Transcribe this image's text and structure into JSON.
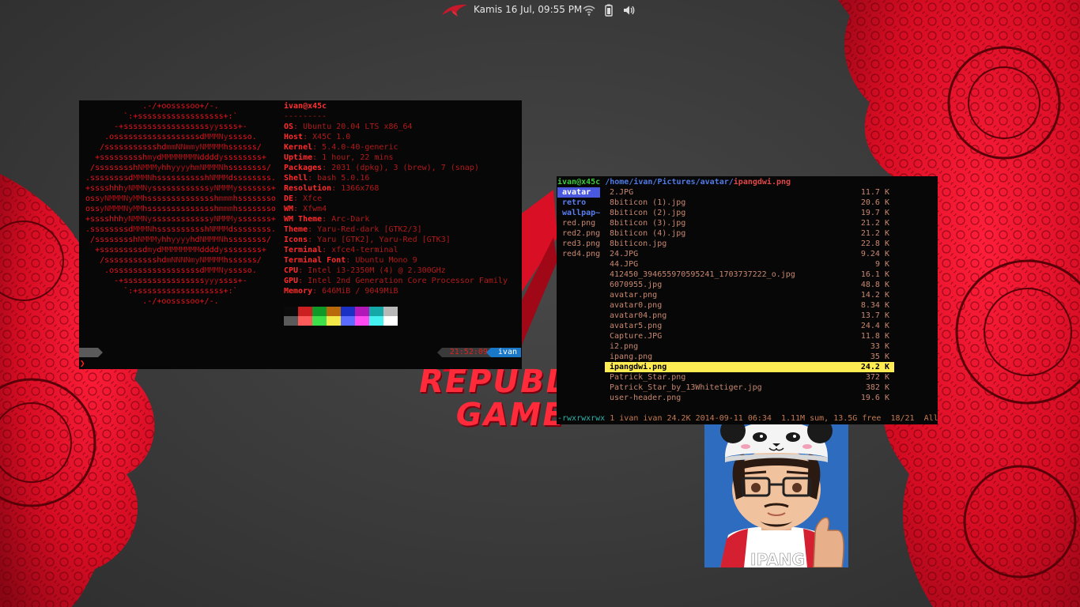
{
  "panel": {
    "logo": "rog-logo-icon",
    "clock": "Kamis 16 Jul, 09:55 PM",
    "tray_icons": [
      "wifi-icon",
      "battery-icon",
      "volume-icon"
    ]
  },
  "wallpaper": {
    "text_line1": "REPUBL",
    "text_line2": "GAME",
    "accent": "#e3102a"
  },
  "neofetch": {
    "ascii": [
      "             .-/+oossssoo+/-.",
      "         `:+ssssssssssssssssss+:`",
      "       -+ssssssssssssssssssyyssss+-",
      "     .ossssssssssssssssssdMMMNysssso.",
      "    /ssssssssssshdmmNNmmyNMMMMhssssss/",
      "   +ssssssssshmydMMMMMMMNddddyssssssss+",
      "  /sssssssshNMMMyhhyyyyhmNMMMNhssssssss/",
      " .ssssssssdMMMNhsssssssssshNMMMdssssssss.",
      " +sssshhhyNMMNyssssssssssssyNMMMysssssss+",
      " ossyNMMMNyMMhsssssssssssssshmmmhssssssso",
      " ossyNMMMNyMMhsssssssssssssshmmmhssssssso",
      " +sssshhhyNMMNyssssssssssssyNMMMysssssss+",
      " .ssssssssdMMMNhsssssssssshNMMMdssssssss.",
      "  /sssssssshNMMMyhhyyyyhdNMMMNhssssssss/",
      "   +sssssssssdmydMMMMMMMMddddyssssssss+",
      "    /ssssssssssshdmNNNNmyNMMMMhssssss/",
      "     .ossssssssssssssssssdMMMNysssso.",
      "       -+sssssssssssssssssyyyssss+-",
      "         `:+ssssssssssssssssss+:`",
      "             .-/+oossssoo+/-."
    ],
    "title": "ivan@x45c",
    "separator": "---------",
    "info": [
      {
        "key": "OS",
        "value": "Ubuntu 20.04 LTS x86_64"
      },
      {
        "key": "Host",
        "value": "X45C 1.0"
      },
      {
        "key": "Kernel",
        "value": "5.4.0-40-generic"
      },
      {
        "key": "Uptime",
        "value": "1 hour, 22 mins"
      },
      {
        "key": "Packages",
        "value": "2031 (dpkg), 3 (brew), 7 (snap)"
      },
      {
        "key": "Shell",
        "value": "bash 5.0.16"
      },
      {
        "key": "Resolution",
        "value": "1366x768"
      },
      {
        "key": "DE",
        "value": "Xfce"
      },
      {
        "key": "WM",
        "value": "Xfwm4"
      },
      {
        "key": "WM Theme",
        "value": "Arc-Dark"
      },
      {
        "key": "Theme",
        "value": "Yaru-Red-dark [GTK2/3]"
      },
      {
        "key": "Icons",
        "value": "Yaru [GTK2], Yaru-Red [GTK3]"
      },
      {
        "key": "Terminal",
        "value": "xfce4-terminal"
      },
      {
        "key": "Terminal Font",
        "value": "Ubuntu Mono 9"
      },
      {
        "key": "CPU",
        "value": "Intel i3-2350M (4) @ 2.300GHz"
      },
      {
        "key": "GPU",
        "value": "Intel 2nd Generation Core Processor Family"
      },
      {
        "key": "Memory",
        "value": "646MiB / 9049MiB"
      }
    ],
    "palette_top": [
      "#0a0a0a",
      "#cc1f1f",
      "#0f9a28",
      "#b86a0a",
      "#1a2fc4",
      "#b217b8",
      "#15a8a8",
      "#b8b8b8"
    ],
    "palette_bottom": [
      "#5a5a5a",
      "#ff5a5a",
      "#3de04a",
      "#f2e84a",
      "#5a6cff",
      "#ff4af0",
      "#45f0f0",
      "#ffffff"
    ],
    "prompt": {
      "time": "21:52:09",
      "user": "ivan",
      "caret": "❯"
    }
  },
  "ranger": {
    "user": "ivan@x45c",
    "path": "/home/ivan/Pictures/avatar/",
    "file": "ipangdwi.png",
    "left_dirs": [
      {
        "label": "avatar",
        "selected": true
      },
      {
        "label": "retro",
        "selected": false
      },
      {
        "label": "wallpap~",
        "selected": false
      }
    ],
    "left_files": [
      "red.png",
      "red2.png",
      "red3.png",
      "red4.png"
    ],
    "files": [
      {
        "name": "2.JPG",
        "size": "11.7 K"
      },
      {
        "name": "8biticon (1).jpg",
        "size": "20.6 K"
      },
      {
        "name": "8biticon (2).jpg",
        "size": "19.7 K"
      },
      {
        "name": "8biticon (3).jpg",
        "size": "21.2 K"
      },
      {
        "name": "8biticon (4).jpg",
        "size": "21.2 K"
      },
      {
        "name": "8biticon.jpg",
        "size": "22.8 K"
      },
      {
        "name": "24.JPG",
        "size": "9.24 K"
      },
      {
        "name": "44.JPG",
        "size": "9 K"
      },
      {
        "name": "412450_394655970595241_1703737222_o.jpg",
        "size": "16.1 K"
      },
      {
        "name": "6070955.jpg",
        "size": "48.8 K"
      },
      {
        "name": "avatar.png",
        "size": "14.2 K"
      },
      {
        "name": "avatar0.png",
        "size": "8.34 K"
      },
      {
        "name": "avatar04.png",
        "size": "13.7 K"
      },
      {
        "name": "avatar5.png",
        "size": "24.4 K"
      },
      {
        "name": "Capture.JPG",
        "size": "11.8 K"
      },
      {
        "name": "i2.png",
        "size": "33 K"
      },
      {
        "name": "ipang.png",
        "size": "35 K"
      },
      {
        "name": "ipangdwi.png",
        "size": "24.2 K",
        "selected": true
      },
      {
        "name": "Patrick_Star.png",
        "size": "372 K"
      },
      {
        "name": "Patrick_Star_by_13Whitetiger.jpg",
        "size": "382 K"
      },
      {
        "name": "user-header.png",
        "size": "19.6 K"
      }
    ],
    "status_perms": "-rwxrwxrwx",
    "status_rest": " 1 ivan ivan 24.2K 2014-09-11 06:34  1.11M sum, 13.5G free  18/21  All",
    "preview_caption": "IPANG"
  }
}
